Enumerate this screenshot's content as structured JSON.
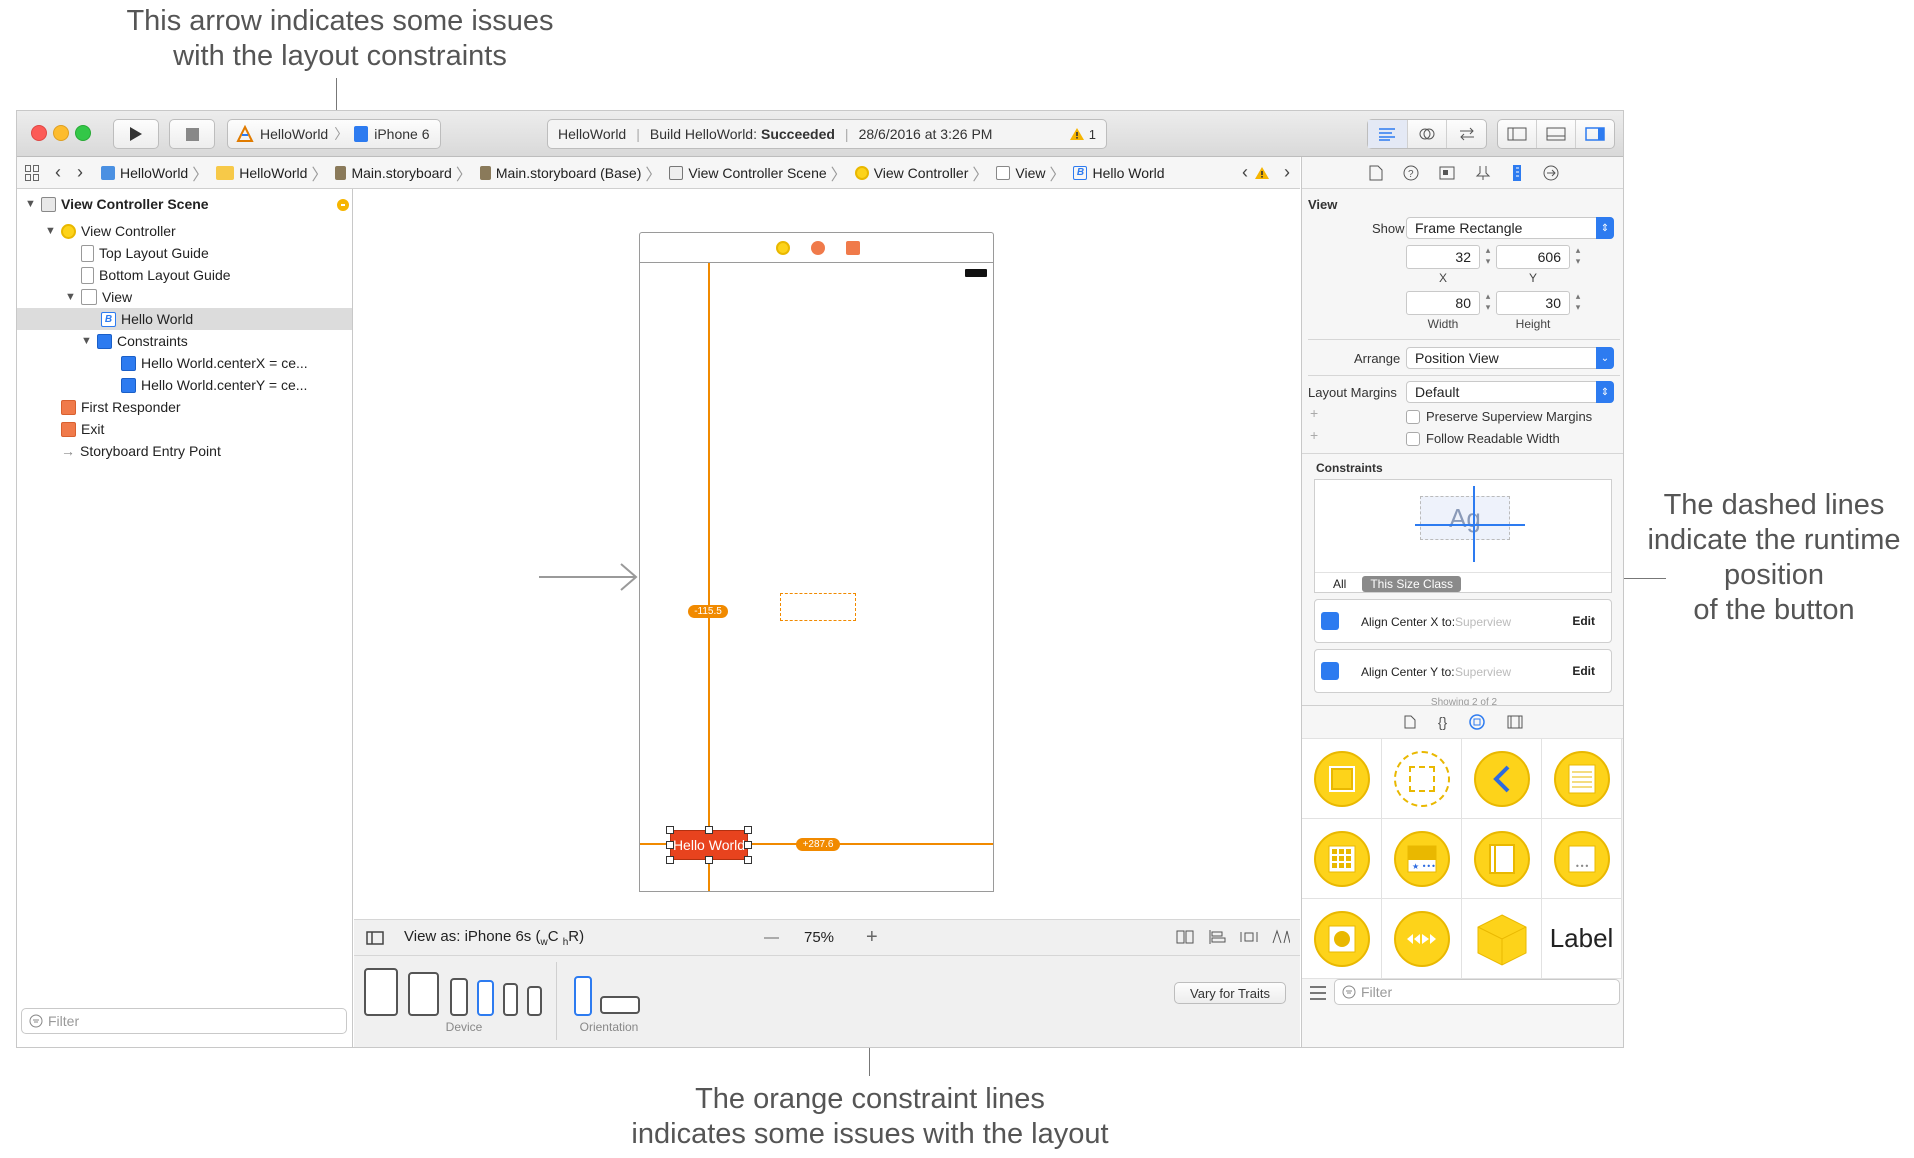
{
  "callouts": {
    "top": "This arrow indicates some issues\nwith the layout constraints",
    "right": "The dashed lines\nindicate the runtime\nposition\nof the button",
    "bottom": "The orange constraint lines\nindicates some issues with the layout"
  },
  "toolbar": {
    "scheme": "HelloWorld",
    "device": "iPhone 6",
    "activity_project": "HelloWorld",
    "activity_build_prefix": "Build HelloWorld:",
    "activity_build_status": "Succeeded",
    "activity_time": "28/6/2016 at 3:26 PM",
    "warning_count": "1"
  },
  "jumpbar": {
    "items": [
      "HelloWorld",
      "HelloWorld",
      "Main.storyboard",
      "Main.storyboard (Base)",
      "View Controller Scene",
      "View Controller",
      "View",
      "Hello World"
    ]
  },
  "navigator": {
    "items": [
      "View Controller Scene",
      "View Controller",
      "Top Layout Guide",
      "Bottom Layout Guide",
      "View",
      "Hello World",
      "Constraints",
      "Hello World.centerX = ce...",
      "Hello World.centerY = ce...",
      "First Responder",
      "Exit",
      "Storyboard Entry Point"
    ],
    "filter_placeholder": "Filter"
  },
  "canvas": {
    "button_label": "Hello World",
    "badge_vertical": "-115.5",
    "badge_horizontal": "+287.6"
  },
  "bottombar": {
    "view_as_prefix": "View as: iPhone 6s (",
    "size_w": "w",
    "size_w_class": "C",
    "size_h": "h",
    "size_h_class": "R",
    "view_as_suffix": ")",
    "zoom_minus": "—",
    "zoom": "75%",
    "zoom_plus": "+",
    "device_label": "Device",
    "orientation_label": "Orientation",
    "vary_button": "Vary for Traits"
  },
  "inspector": {
    "section": "View",
    "show_label": "Show",
    "show_value": "Frame Rectangle",
    "x_value": "32",
    "y_value": "606",
    "x_label": "X",
    "y_label": "Y",
    "width_value": "80",
    "height_value": "30",
    "width_label": "Width",
    "height_label": "Height",
    "arrange_label": "Arrange",
    "arrange_value": "Position View",
    "margins_label": "Layout Margins",
    "margins_value": "Default",
    "preserve_label": "Preserve Superview Margins",
    "readable_label": "Follow Readable Width",
    "constraints_title": "Constraints",
    "preview_text": "Ag",
    "tab_all": "All",
    "tab_size_class": "This Size Class",
    "constraint1_label": "Align Center X to:",
    "constraint2_label": "Align Center Y to:",
    "constraint_target": "Superview",
    "edit": "Edit",
    "showing": "Showing 2 of 2",
    "library_label_item": "Label",
    "library_filter_placeholder": "Filter"
  },
  "colors": {
    "accent_orange": "#f18a00",
    "selection_blue": "#2d7bf0",
    "library_yellow": "#fdd31a"
  }
}
